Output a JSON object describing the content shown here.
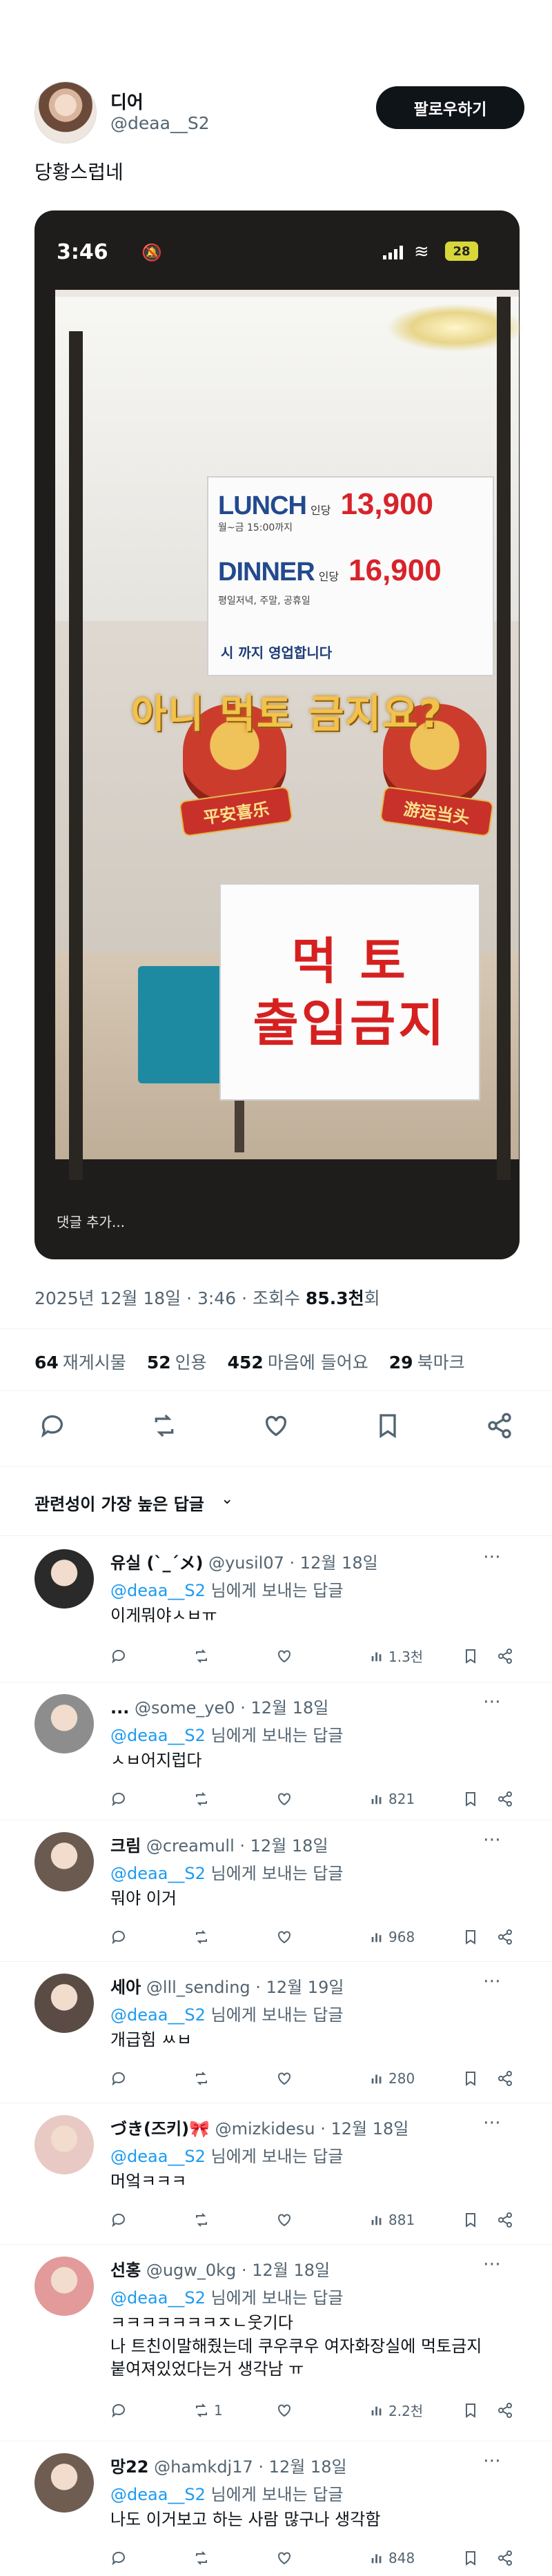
{
  "author": {
    "display_name": "디어",
    "handle": "@deaa__S2",
    "follow_label": "팔로우하기"
  },
  "tweet": {
    "text": "당황스럽네"
  },
  "video": {
    "status_time": "3:46",
    "battery": "28",
    "menu_sign": {
      "lunch_name": "LUNCH",
      "lunch_per": "인당",
      "lunch_price": "13,900",
      "lunch_sub": "월~금 15:00까지",
      "dinner_name": "DINNER",
      "dinner_per": "인당",
      "dinner_price": "16,900",
      "dinner_sub": "평일저녁, 주말, 공휴일",
      "closing_note": "시 까지 영업합니다"
    },
    "overlay_caption": "아니 먹토 금지요?",
    "lion_left_tag": "平安喜乐",
    "lion_right_tag": "游运当头",
    "no_entry_line1": "먹 토",
    "no_entry_line2": "출입금지",
    "comment_placeholder": "댓글 추가..."
  },
  "meta": {
    "date": "2025년 12월 18일 · 3:46 · 조회수",
    "views": "85.3천",
    "views_suffix": "회"
  },
  "stats": [
    {
      "count": "64",
      "label": "재게시물"
    },
    {
      "count": "52",
      "label": "인용"
    },
    {
      "count": "452",
      "label": "마음에 들어요"
    },
    {
      "count": "29",
      "label": "북마크"
    }
  ],
  "sort": {
    "label": "관련성이 가장 높은 답글",
    "icon": "chevron-down-icon"
  },
  "replies": [
    {
      "name": "유실 (`_´メ)",
      "handle": "@yusil07",
      "date": "12월 18일",
      "mention": "@deaa__S2",
      "to_suffix": "님에게 보내는 답글",
      "body": "이게뭐야ㅅㅂㅠ",
      "retweets": "",
      "views": "1.3천",
      "avatar_color": "#2a2a2a"
    },
    {
      "name": "...",
      "handle": "@some_ye0",
      "date": "12월 18일",
      "mention": "@deaa__S2",
      "to_suffix": "님에게 보내는 답글",
      "body": "ㅅㅂ어지럽다",
      "retweets": "",
      "views": "821",
      "avatar_color": "#8d8d8d"
    },
    {
      "name": "크림",
      "handle": "@creamull",
      "date": "12월 18일",
      "mention": "@deaa__S2",
      "to_suffix": "님에게 보내는 답글",
      "body": "뭐야 이거",
      "retweets": "",
      "views": "968",
      "avatar_color": "#6b5a50"
    },
    {
      "name": "세아",
      "handle": "@lll_sending",
      "date": "12월 19일",
      "mention": "@deaa__S2",
      "to_suffix": "님에게 보내는 답글",
      "body": "개급힘 ㅆㅂ",
      "retweets": "",
      "views": "280",
      "avatar_color": "#5b4b45"
    },
    {
      "name": "づき(즈키)🎀",
      "handle": "@mizkidesu",
      "date": "12월 18일",
      "mention": "@deaa__S2",
      "to_suffix": "님에게 보내는 답글",
      "body": "머엌ㅋㅋㅋ",
      "retweets": "",
      "views": "881",
      "avatar_color": "#e8c9c4"
    },
    {
      "name": "선홍",
      "handle": "@ugw_0kg",
      "date": "12월 18일",
      "mention": "@deaa__S2",
      "to_suffix": "님에게 보내는 답글",
      "body": "ㅋㅋㅋㅋㅋㅋㅋㅈㄴ웃기다\n나 트친이말해줬는데 쿠우쿠우 여자화장실에 먹토금지\n붙여져있었다는거 생각남 ㅠ",
      "retweets": "1",
      "views": "2.2천",
      "avatar_color": "#e39a9a"
    },
    {
      "name": "망22",
      "handle": "@hamkdj17",
      "date": "12월 18일",
      "mention": "@deaa__S2",
      "to_suffix": "님에게 보내는 답글",
      "body": "나도 이거보고 하는 사람 많구나 생각함",
      "retweets": "",
      "views": "848",
      "avatar_color": "#6f5d52"
    }
  ]
}
